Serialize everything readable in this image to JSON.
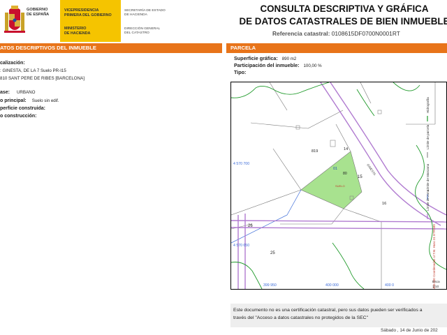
{
  "header": {
    "gov_lines": [
      "GOBIERNO",
      "DE ESPAÑA"
    ],
    "yellow_1": [
      "VICEPRESIDENCIA",
      "PRIMERA DEL GOBIERNO"
    ],
    "yellow_2": [
      "MINISTERIO",
      "DE HACIENDA"
    ],
    "dir_1": [
      "SECRETARÍA DE ESTADO",
      "DE HACIENDA"
    ],
    "dir_2": [
      "DIRECCIÓN GENERAL",
      "DEL CATASTRO"
    ],
    "title_1": "CONSULTA DESCRIPTIVA Y GRÁFICA",
    "title_2": "DE DATOS CATASTRALES DE BIEN INMUEBLE",
    "ref_label": "Referencia catastral:",
    "ref_value": "0108615DF0700N0001RT"
  },
  "sections": {
    "left_title": "ATOS DESCRIPTIVOS DEL INMUEBLE",
    "right_title": "PARCELA"
  },
  "left_info": {
    "loc_label": "calización:",
    "loc_line1": ": GINESTA, DE LA 7 Suelo PR-I15",
    "loc_line2": "810 SANT PERE DE RIBES [BARCELONA]",
    "clase_label": "ase:",
    "clase_value": "URBANO",
    "uso_label": "o principal:",
    "uso_value": "Suelo sin edif.",
    "sup_label": "perficie construida:",
    "anio_label": "o construcción:"
  },
  "right_info": {
    "sup_label": "Superficie gráfica:",
    "sup_value": "890 m2",
    "part_label": "Participación del inmueble:",
    "part_value": "100,00 %",
    "tipo_label": "Tipo:"
  },
  "map": {
    "labels": {
      "p19": "819",
      "p14": "14",
      "p80": "80",
      "p15": "15",
      "p16": "16",
      "p26": "26",
      "p25": "25",
      "suelo": "SUELO",
      "street": "GINESTA",
      "num_small": "01"
    },
    "coords": {
      "y1": "4 570 700",
      "y2": "4 570 650",
      "x1": "399 950",
      "x2": "400 000",
      "x3": "400 0"
    },
    "legend": {
      "hidro": "Hidrografía",
      "parcela": "Límite de parcela",
      "mzna": "Límite de Manzana",
      "zona": "Límite de zona"
    },
    "projection": "400.000 Coordenadas U.T.M. Huso 31 ETRS89",
    "scale_label": "Esca",
    "scale_value": "1/10"
  },
  "footer": {
    "note_1": "Este documento no es una certificación catastral, pero sus datos pueden ser verificados a",
    "note_2": "través del \"Acceso a datos catastrales no protegidos de la SEC\"",
    "date": "Sábado , 14 de Junio de 202"
  },
  "colors": {
    "orange": "#e8741a",
    "yellow": "#f5c400",
    "parcel_fill": "#a8e28f",
    "road": "#b07ad0",
    "hydro": "#1f9a2a",
    "boundary": "#3b6bd8"
  }
}
